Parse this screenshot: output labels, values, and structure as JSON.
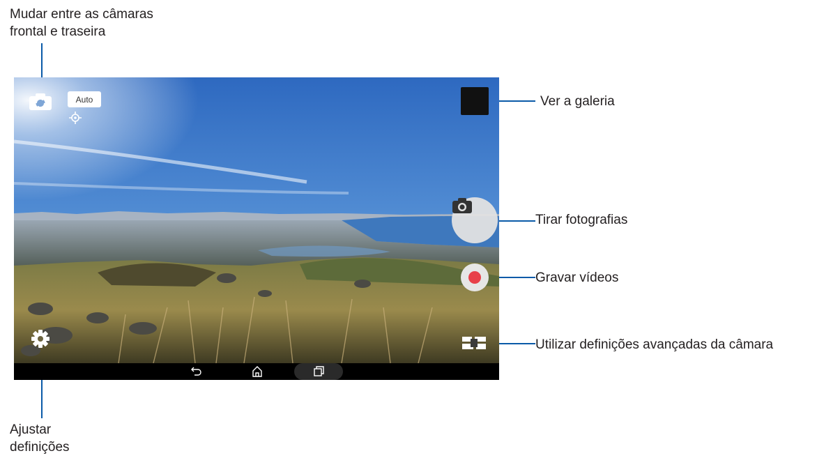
{
  "callouts": {
    "switch_camera_line1": "Mudar entre as câmaras",
    "switch_camera_line2": "frontal e traseira",
    "gallery": "Ver a galeria",
    "take_photo": "Tirar fotografias",
    "record_video": "Gravar vídeos",
    "advanced_settings": "Utilizar definições avançadas da câmara",
    "adjust_settings_line1": "Ajustar",
    "adjust_settings_line2": "definições"
  },
  "camera": {
    "mode_badge": "Auto",
    "icons": {
      "switch_camera": "camera-switch-icon",
      "focus": "focus-target-icon",
      "gallery": "gallery-thumbnail",
      "shutter": "camera-icon",
      "record": "record-icon",
      "settings": "gear-icon",
      "advanced": "advanced-settings-icon"
    }
  },
  "navbar": {
    "icons": [
      "back-icon",
      "home-icon",
      "recent-apps-icon"
    ]
  },
  "colors": {
    "leader": "#0a5aa8",
    "record": "#e8404a",
    "sky": "#2f6fc4",
    "navbar": "#000000"
  }
}
